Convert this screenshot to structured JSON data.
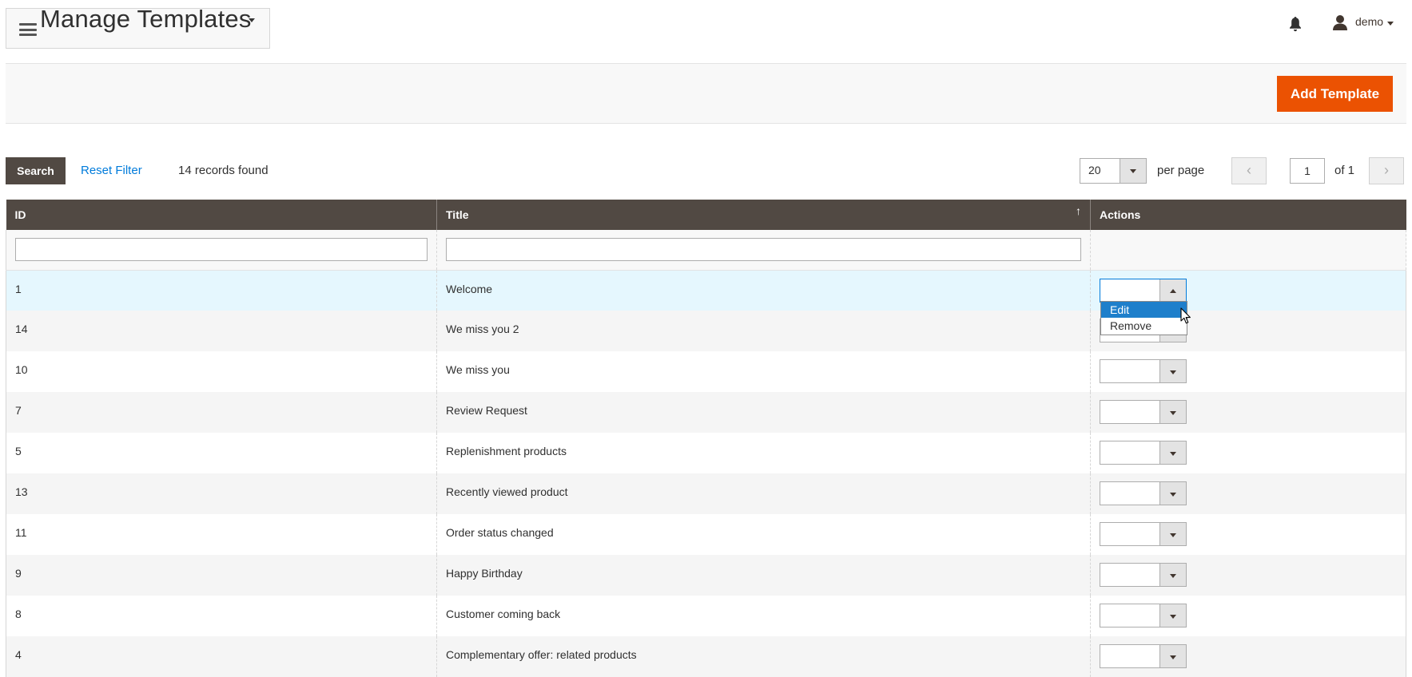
{
  "header": {
    "title": "Manage Templates",
    "user_name": "demo"
  },
  "actions": {
    "add_label": "Add Template"
  },
  "toolbar": {
    "search_label": "Search",
    "reset_label": "Reset Filter",
    "records_found": "14 records found",
    "per_page_value": "20",
    "per_page_label": "per page",
    "prev_glyph": "‹",
    "next_glyph": "›",
    "current_page": "1",
    "of_pages": "of 1"
  },
  "grid": {
    "columns": {
      "id": "ID",
      "title": "Title",
      "actions": "Actions",
      "sort_glyph": "↑"
    },
    "rows": [
      {
        "id": "1",
        "title": "Welcome"
      },
      {
        "id": "14",
        "title": "We miss you 2"
      },
      {
        "id": "10",
        "title": "We miss you"
      },
      {
        "id": "7",
        "title": "Review Request"
      },
      {
        "id": "5",
        "title": "Replenishment products"
      },
      {
        "id": "13",
        "title": "Recently viewed product"
      },
      {
        "id": "11",
        "title": "Order status changed"
      },
      {
        "id": "9",
        "title": "Happy Birthday"
      },
      {
        "id": "8",
        "title": "Customer coming back"
      },
      {
        "id": "4",
        "title": "Complementary offer: related products"
      }
    ],
    "action_options": [
      "Edit",
      "Remove"
    ]
  },
  "colors": {
    "accent": "#eb5202",
    "header_bg": "#514943",
    "link": "#007bdb",
    "highlight": "#1e7fcb"
  }
}
